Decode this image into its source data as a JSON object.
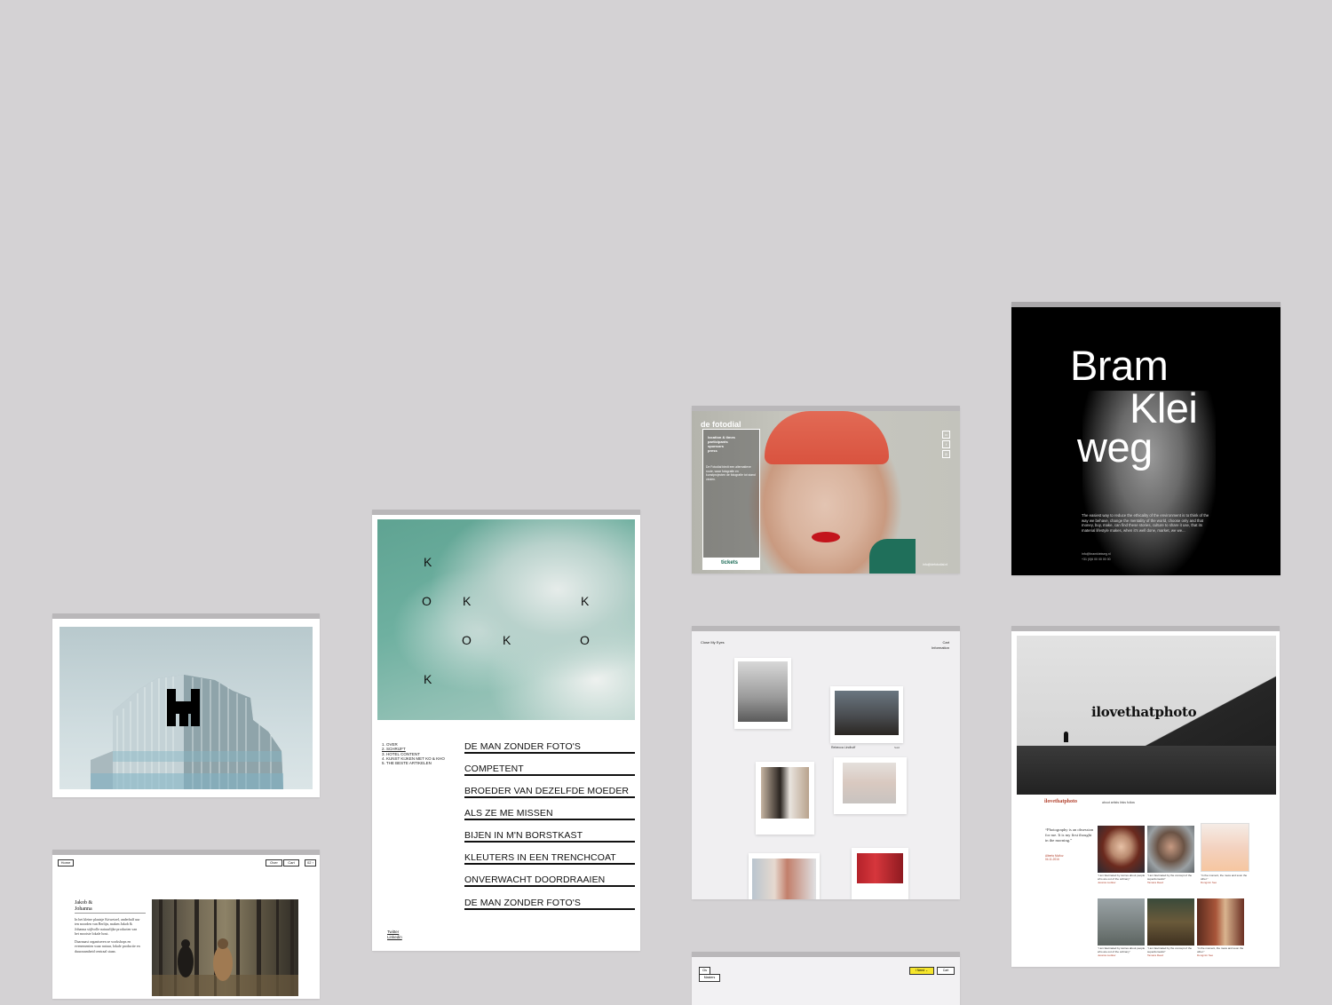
{
  "koko": {
    "letters": [
      "K",
      "O",
      "K",
      "K",
      "O",
      "K",
      "O",
      "K"
    ],
    "menu": [
      "1. OVER",
      "2. SCHRIJFT",
      "3. HOTEL CONTENT",
      "4. KUNST KIJKEN MET KO & KHO",
      "5. THE BESTE ARTIKELEN"
    ],
    "titles": [
      "DE MAN ZONDER FOTO'S",
      "COMPETENT",
      "BROEDER VAN DEZELFDE MOEDER",
      "ALS ZE ME MISSEN",
      "BIJEN IN M'N BORSTKAST",
      "KLEUTERS IN EEN TRENCHCOAT",
      "ONVERWACHT DOORDRAAIEN",
      "DE MAN ZONDER FOTO'S"
    ],
    "footer": [
      "Twitter",
      "Linkedin"
    ]
  },
  "jakob": {
    "nav_left": "Home",
    "nav_right": [
      "Over",
      "Cart",
      "02 ›"
    ],
    "title_line1": "Jakob &",
    "title_line2": "Johanna",
    "paragraph1": "In het kleine plaatsje Kriwetzel, anderhalf uur ten noorden van Berlijn, maken Jakob & Johanna stijlvolle natuurlijke producten van het mooiste lokale hout.",
    "paragraph2": "Daarnaast organiseren ze workshops en evenementen waar natuur, lokale productie en duurzaamheid centraal staan."
  },
  "fotodial": {
    "brand": "de fotodial",
    "nav": [
      "location & times",
      "participants",
      "sponsors",
      "press"
    ],
    "text": "De Fotodial biedt een alternatieve route, waar fotografie en kunstprojecten de fotografie tot stand vinden.",
    "tickets": "tickets",
    "social": [
      "▭",
      "f",
      "◎"
    ],
    "email": "info@defotodial.nl"
  },
  "bram": {
    "name_line1": "Bram",
    "name_line2": "Klei",
    "name_line3": "weg",
    "body": "The easiest way to reduce the ethicality of the environment is to think of the way we behave, change the mentality of the world, choose only and that money, buy, make, can find these stories, culture to share it use, that its material lifestyle makes, when it’s well done, market, we we...",
    "contact_line1": "info@bramkleiweg.nl",
    "contact_line2": "+31 (0)6 00 00 00 00"
  },
  "closeeyes": {
    "logo": "Close My Eyes",
    "nav": [
      "Cart",
      "Information"
    ],
    "caption": "Rebecca Lindhoff",
    "caption_right": "Sold"
  },
  "ilove": {
    "brand": "ilovethatphoto",
    "sub": "ilovethatphoto",
    "sub2": "about   artists   links   follow",
    "quote": "“Photography is an obsession for me. It is my first thought in the morning.”",
    "quote_author": "Alberto Muñoz",
    "quote_date": "04.11.2016",
    "captions": [
      {
        "text": "“I am fascinated by stories about people who are out of the ordinary”",
        "name": "Jessica Ludlow"
      },
      {
        "text": "“I am fascinated by the concept of the superdomestic”",
        "name": "Tamara Reed"
      },
      {
        "text": "“In the moment, the mess and soon the other.”",
        "name": "Dongmin Seo"
      },
      {
        "text": "“I am fascinated by stories about people who are out of the ordinary”",
        "name": "Jessica Ludlow"
      },
      {
        "text": "“I am fascinated by the concept of the superdomestic”",
        "name": "Tamara Reed"
      },
      {
        "text": "“In the moment, the mess and soon the other.”",
        "name": "Dongmin Seo"
      }
    ]
  },
  "bottom": {
    "btn1": "Cls",
    "btn2": "Masters",
    "btn3": "I Need ⌄",
    "btn4": "Cart"
  },
  "colors": {
    "background": "#d4d2d4",
    "koko_teal": "#6eb0a0",
    "fotodial_green": "#1b6b56",
    "ilove_red": "#b3432f",
    "accent_yellow": "#f6e62c"
  }
}
